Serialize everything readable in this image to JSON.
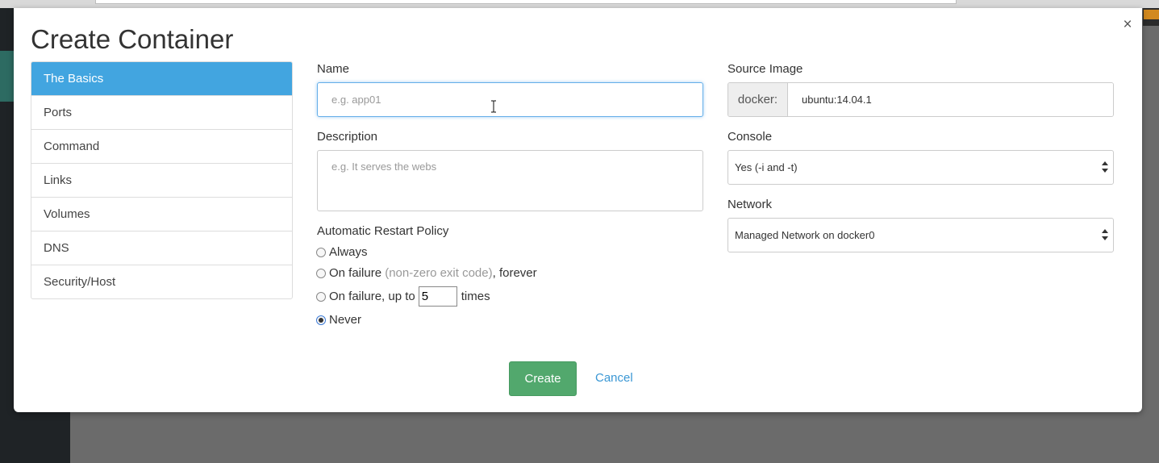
{
  "modal": {
    "title": "Create Container",
    "close_label": "×"
  },
  "sidebar": {
    "items": [
      {
        "label": "The Basics",
        "active": true
      },
      {
        "label": "Ports"
      },
      {
        "label": "Command"
      },
      {
        "label": "Links"
      },
      {
        "label": "Volumes"
      },
      {
        "label": "DNS"
      },
      {
        "label": "Security/Host"
      }
    ]
  },
  "form": {
    "name": {
      "label": "Name",
      "placeholder": "e.g. app01",
      "value": ""
    },
    "description": {
      "label": "Description",
      "placeholder": "e.g. It serves the webs",
      "value": ""
    },
    "restart_policy": {
      "label": "Automatic Restart Policy",
      "always": "Always",
      "on_failure_prefix": "On failure",
      "on_failure_hint": "(non-zero exit code)",
      "on_failure_suffix": ", forever",
      "up_to_prefix": "On failure, up to",
      "up_to_value": "5",
      "up_to_suffix": "times",
      "never": "Never",
      "selected": "never"
    },
    "source_image": {
      "label": "Source Image",
      "prefix": "docker:",
      "value": "ubuntu:14.04.1"
    },
    "console": {
      "label": "Console",
      "value": "Yes (-i and -t)"
    },
    "network": {
      "label": "Network",
      "value": "Managed Network on docker0"
    }
  },
  "actions": {
    "create_label": "Create",
    "cancel_label": "Cancel"
  },
  "colors": {
    "active_tab": "#42a5e0",
    "create_button": "#52a86d",
    "link": "#3a97d4"
  },
  "icons": {
    "close": "close-icon",
    "select_arrows": "select-arrows-icon",
    "cursor": "text-cursor-icon"
  }
}
